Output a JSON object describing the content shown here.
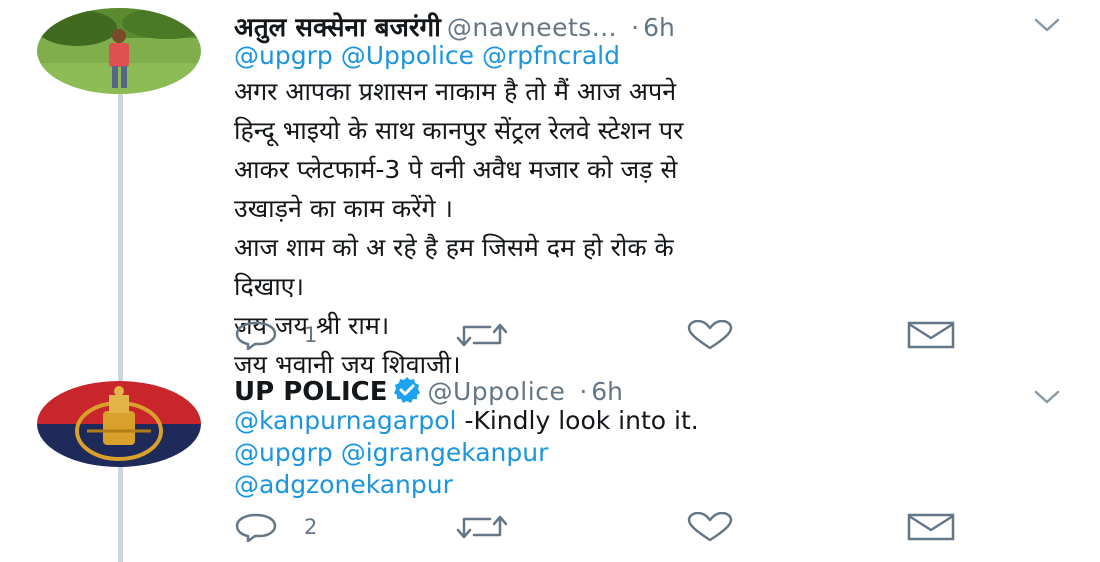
{
  "tweets": [
    {
      "name": "अतुल सक्सेना बजरंगी",
      "handle": "@navneets...",
      "dot": "·",
      "time": "6h",
      "verified": false,
      "mentions": [
        "@upgrp",
        "@Uppolice",
        "@rpfncrald"
      ],
      "text_lines": [
        "अगर आपका प्रशासन नाकाम है तो मैं आज अपने",
        "हिन्दू भाइयो के साथ कानपुर सेंट्रल रेलवे स्टेशन पर",
        "आकर प्लेटफार्म-3 पे वनी अवैध मजार को जड़ से",
        "उखाड़ने का काम करेंगे ।",
        "आज शाम को अ रहे है हम जिसमे दम हो रोक के",
        "दिखाए।",
        "जय जय श्री राम।",
        "जय भवानी जय शिवाजी।"
      ],
      "reply_count": "1"
    },
    {
      "name": "UP POLICE",
      "handle": "@Uppolice",
      "dot": "·",
      "time": "6h",
      "verified": true,
      "line1_mention": "@kanpurnagarpol",
      "line1_text": " -Kindly look into it.",
      "line2_mentions": [
        "@upgrp",
        "@igrangekanpur"
      ],
      "line3_mention": "@adgzonekanpur",
      "reply_count": "2"
    }
  ],
  "icons": {
    "reply": "reply-icon",
    "retweet": "retweet-icon",
    "like": "heart-icon",
    "dm": "envelope-icon",
    "caret": "chevron-down-icon",
    "verified": "verified-badge-icon"
  },
  "colors": {
    "mention": "#1b95e0",
    "secondary": "#657786",
    "thread_line": "#ccd6dd",
    "verified": "#1da1f2"
  }
}
